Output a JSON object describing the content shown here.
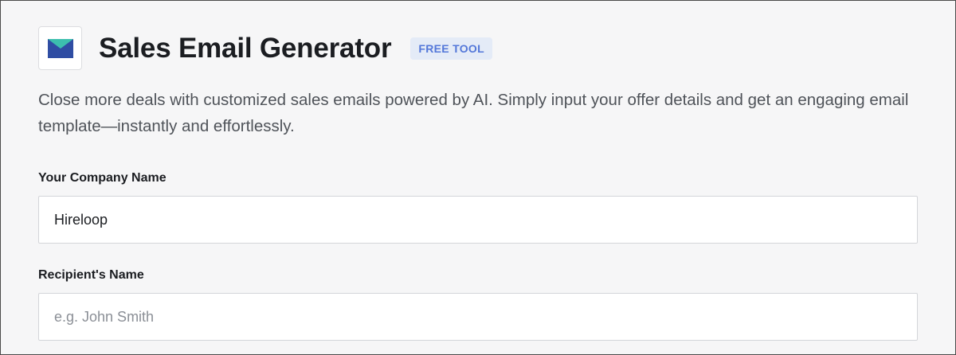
{
  "header": {
    "logo_icon": "envelope-icon",
    "title": "Sales Email Generator",
    "badge": "FREE TOOL"
  },
  "description": "Close more deals with customized sales emails powered by AI. Simply input your offer details and get an engaging email template—instantly and effortlessly.",
  "form": {
    "company_name": {
      "label": "Your Company Name",
      "value": "Hireloop",
      "placeholder": ""
    },
    "recipient_name": {
      "label": "Recipient's Name",
      "value": "",
      "placeholder": "e.g. John Smith"
    }
  },
  "colors": {
    "badge_bg": "#e4ebf7",
    "badge_text": "#5377d9",
    "envelope_body": "#2f4da3",
    "envelope_flap": "#3cbfae"
  }
}
